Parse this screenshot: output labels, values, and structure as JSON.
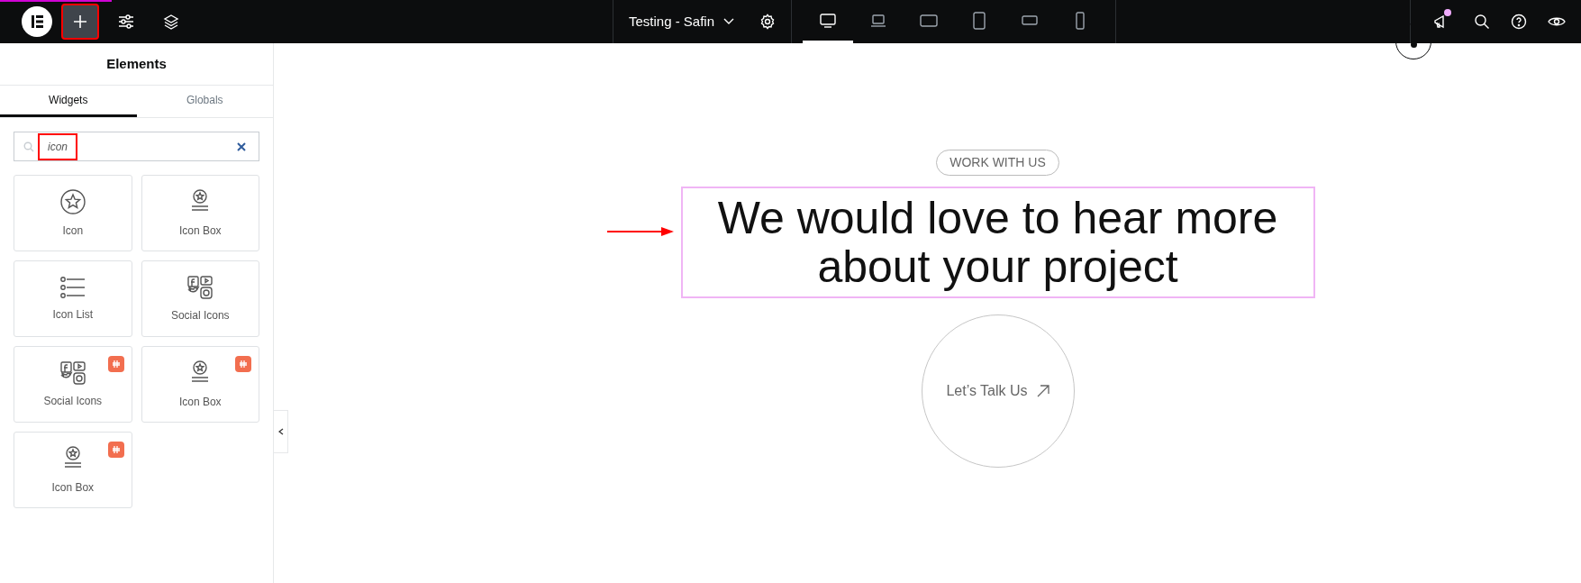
{
  "top_bar": {
    "add_button": {
      "highlighted": true
    },
    "document_title": "Testing - Safin",
    "devices": [
      {
        "kind": "desktop",
        "selected": true
      },
      {
        "kind": "laptop",
        "selected": false
      },
      {
        "kind": "tablet-landscape",
        "selected": false
      },
      {
        "kind": "tablet",
        "selected": false
      },
      {
        "kind": "mobile-landscape",
        "selected": false
      },
      {
        "kind": "mobile",
        "selected": false
      }
    ],
    "notifications": {
      "unread": true
    }
  },
  "panel": {
    "title": "Elements",
    "tabs": [
      {
        "label": "Widgets",
        "selected": true
      },
      {
        "label": "Globals",
        "selected": false
      }
    ],
    "search": {
      "value": "icon",
      "highlighted": true
    },
    "widgets": [
      {
        "kind": "icon",
        "label": "Icon",
        "pro": false
      },
      {
        "kind": "icon-box",
        "label": "Icon Box",
        "pro": false
      },
      {
        "kind": "icon-list",
        "label": "Icon List",
        "pro": false
      },
      {
        "kind": "social",
        "label": "Social Icons",
        "pro": false
      },
      {
        "kind": "social",
        "label": "Social Icons",
        "pro": true
      },
      {
        "kind": "icon-box",
        "label": "Icon Box",
        "pro": true
      },
      {
        "kind": "icon-box",
        "label": "Icon Box",
        "pro": true
      }
    ]
  },
  "canvas": {
    "tag": "WORK WITH US",
    "heading": "We would love to hear more about your project",
    "heading_selected": true,
    "button": "Let’s Talk Us"
  }
}
